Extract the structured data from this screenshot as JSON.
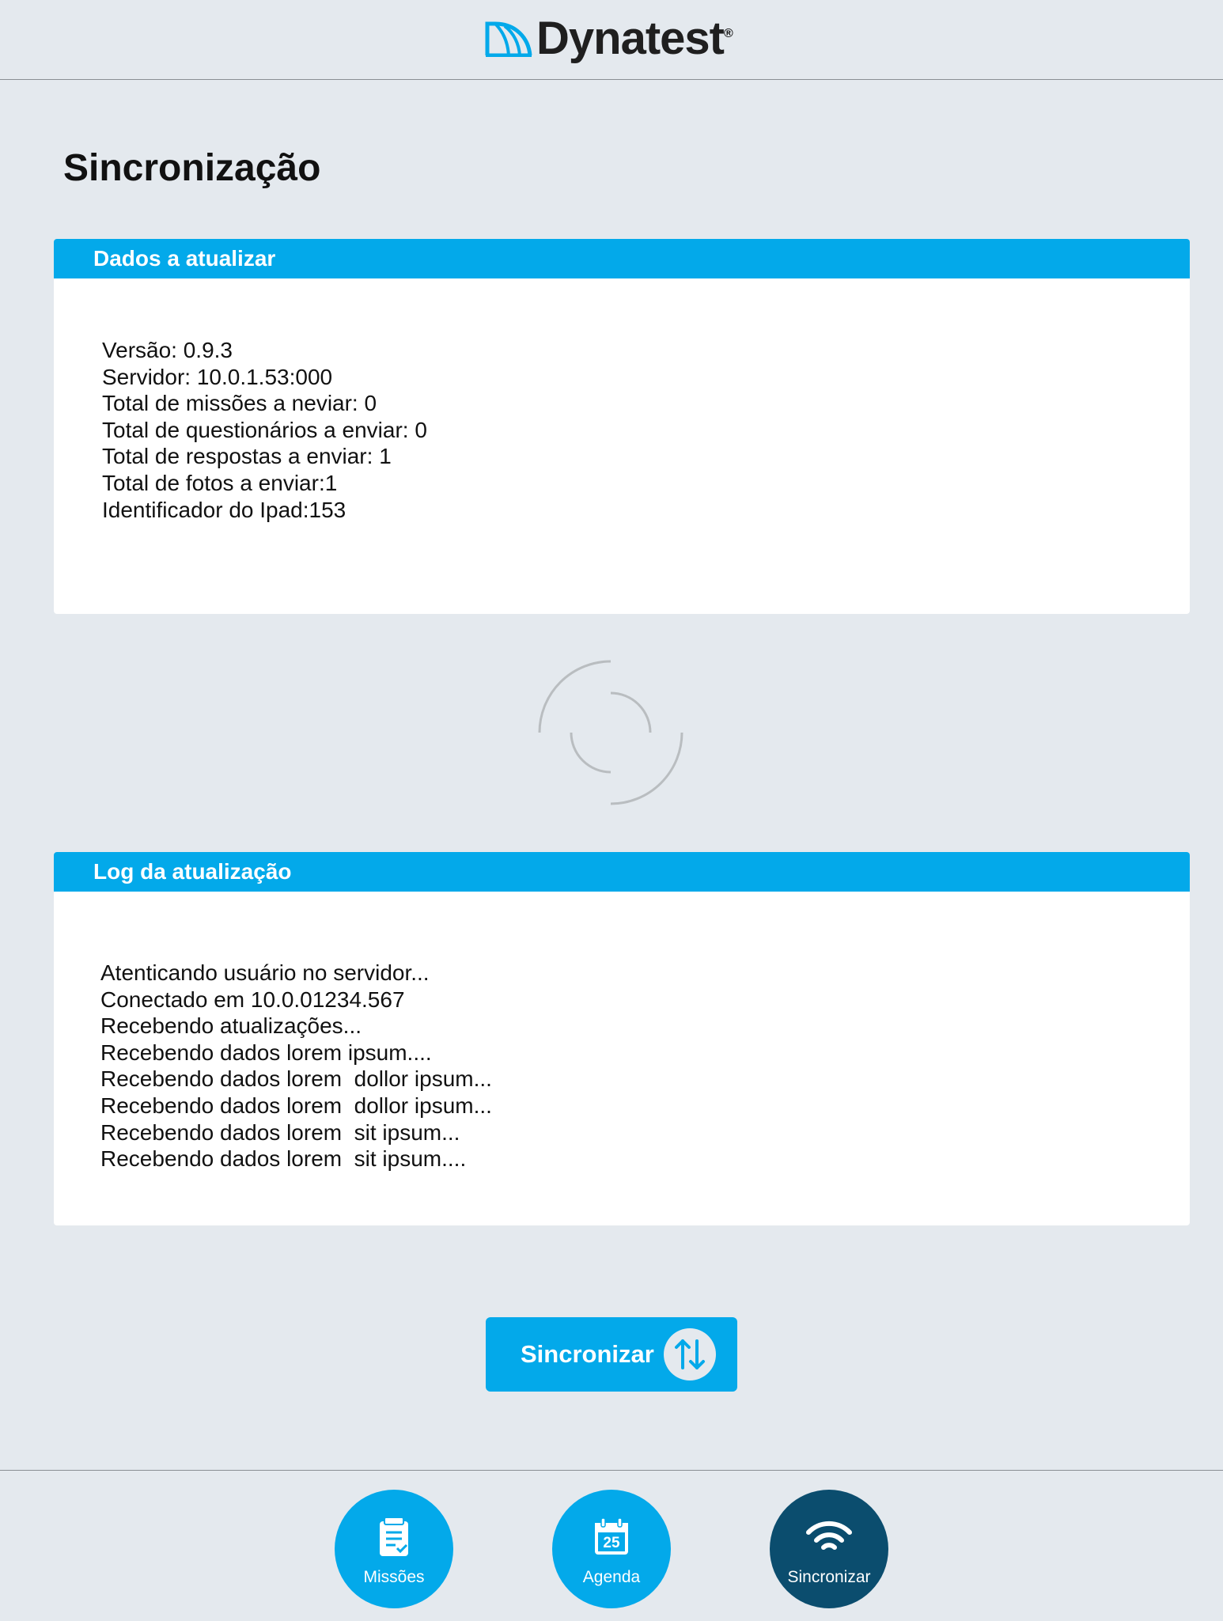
{
  "header": {
    "logo_text": "Dynatest",
    "logo_reg": "®"
  },
  "page": {
    "title": "Sincronização"
  },
  "data_panel": {
    "title": "Dados a atualizar",
    "lines": [
      "Versão: 0.9.3",
      "Servidor: 10.0.1.53:000",
      "Total de missões a neviar: 0",
      "Total de questionários a enviar: 0",
      "Total de respostas a enviar: 1",
      "Total de fotos a enviar:1",
      "Identificador do Ipad:153"
    ]
  },
  "log_panel": {
    "title": "Log da atualização",
    "lines": [
      "Atenticando usuário no servidor...",
      "Conectado em 10.0.01234.567",
      "Recebendo atualizações...",
      "Recebendo dados lorem ipsum....",
      "Recebendo dados lorem  dollor ipsum...",
      "Recebendo dados lorem  dollor ipsum...",
      "Recebendo dados lorem  sit ipsum...",
      "Recebendo dados lorem  sit ipsum...."
    ]
  },
  "sync_button": {
    "label": "Sincronizar",
    "icon": "sync-arrows-icon"
  },
  "nav": {
    "items": [
      {
        "label": "Missões",
        "icon": "clipboard-check-icon",
        "active": false
      },
      {
        "label": "Agenda",
        "icon": "calendar-icon",
        "active": false,
        "calendar_day": "25"
      },
      {
        "label": "Sincronizar",
        "icon": "wifi-icon",
        "active": true
      }
    ]
  },
  "colors": {
    "accent": "#03a9ea",
    "active_nav": "#0b4d6e",
    "background": "#e4e9ee",
    "panel": "#ffffff",
    "spinner": "#b9bdc0"
  }
}
